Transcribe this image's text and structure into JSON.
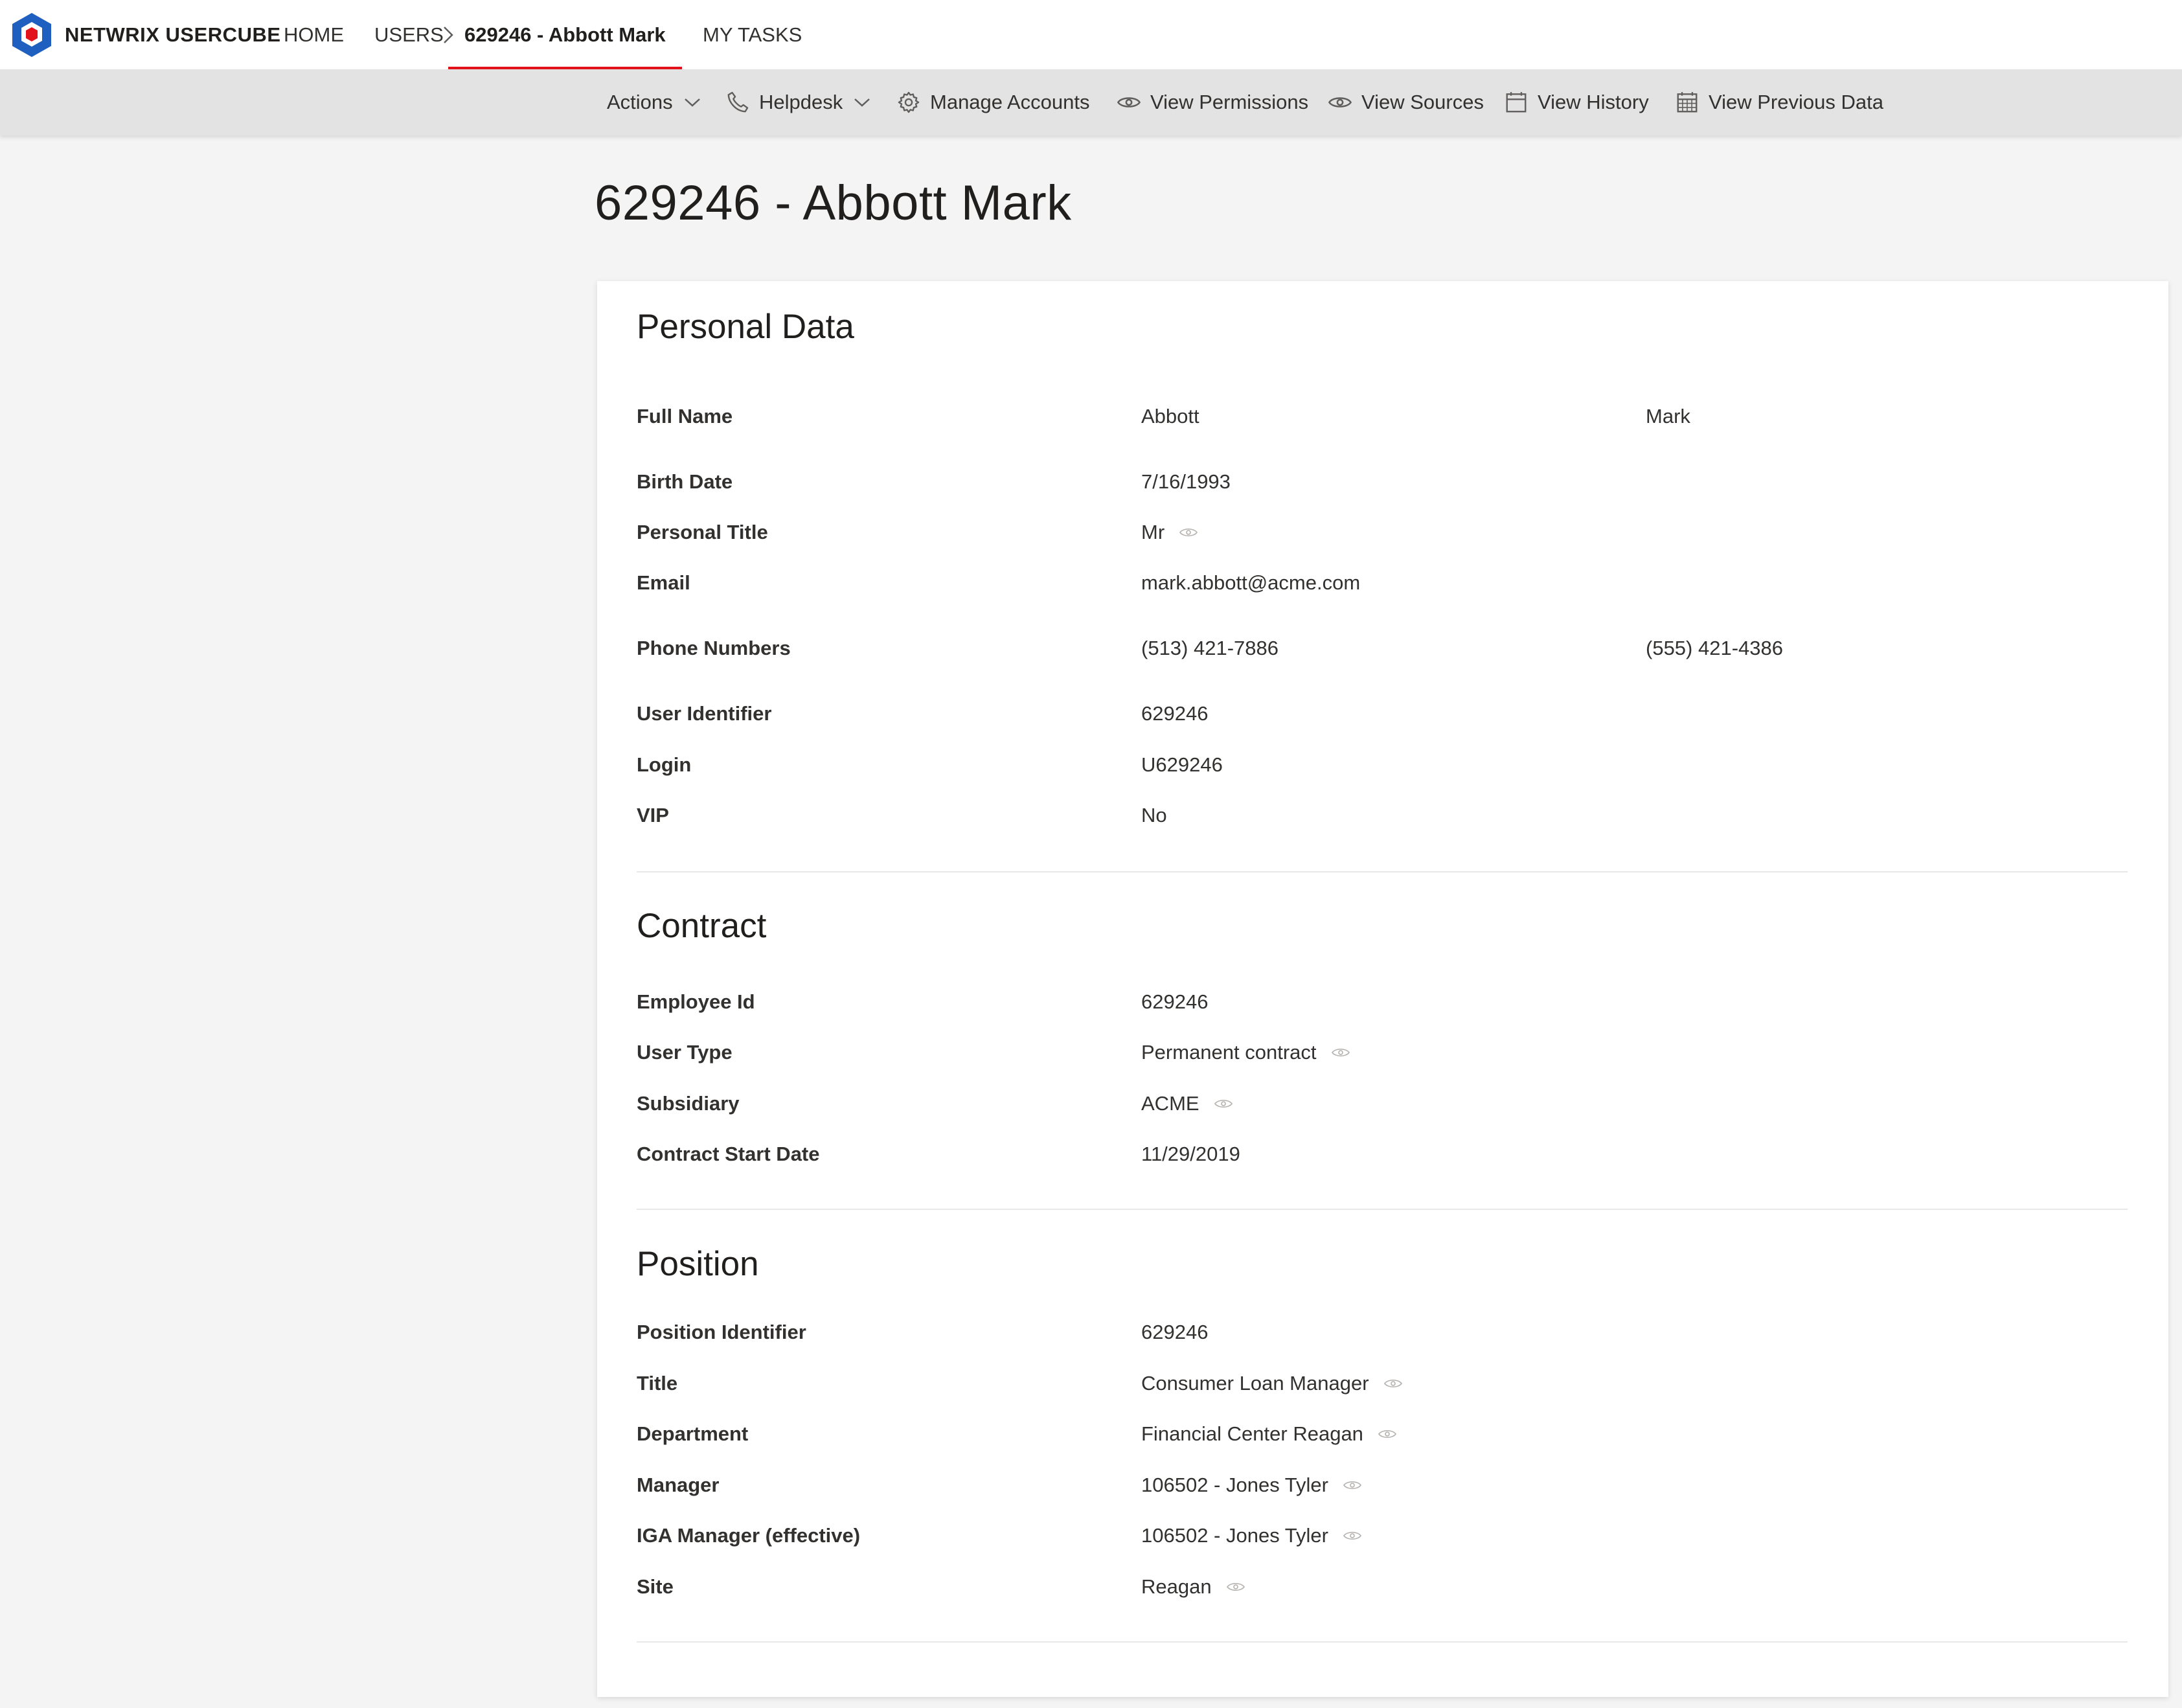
{
  "brand": {
    "name": "NETWRIX USERCUBE",
    "accent": "#e3131b",
    "logo_color": "#1f5fbf"
  },
  "nav": {
    "home": "HOME",
    "users": "USERS",
    "current": "629246 - Abbott Mark",
    "tasks": "MY TASKS"
  },
  "commands": {
    "actions": "Actions",
    "helpdesk": "Helpdesk",
    "manage_accounts": "Manage Accounts",
    "view_permissions": "View Permissions",
    "view_sources": "View Sources",
    "view_history": "View History",
    "view_previous_data": "View Previous Data"
  },
  "page_title": "629246 - Abbott Mark",
  "personal": {
    "title": "Personal Data",
    "full_name": {
      "label": "Full Name",
      "value": "Abbott",
      "value2": "Mark"
    },
    "birth_date": {
      "label": "Birth Date",
      "value": "7/16/1993"
    },
    "personal_title": {
      "label": "Personal Title",
      "value": "Mr"
    },
    "email": {
      "label": "Email",
      "value": "mark.abbott@acme.com"
    },
    "phones": {
      "label": "Phone Numbers",
      "value": "(513) 421-7886",
      "value2": "(555) 421-4386"
    },
    "user_identifier": {
      "label": "User Identifier",
      "value": "629246"
    },
    "login": {
      "label": "Login",
      "value": "U629246"
    },
    "vip": {
      "label": "VIP",
      "value": "No"
    }
  },
  "contract": {
    "title": "Contract",
    "employee_id": {
      "label": "Employee Id",
      "value": "629246"
    },
    "user_type": {
      "label": "User Type",
      "value": "Permanent contract"
    },
    "subsidiary": {
      "label": "Subsidiary",
      "value": "ACME"
    },
    "start_date": {
      "label": "Contract Start Date",
      "value": "11/29/2019"
    }
  },
  "position": {
    "title": "Position",
    "identifier": {
      "label": "Position Identifier",
      "value": "629246"
    },
    "job_title": {
      "label": "Title",
      "value": "Consumer Loan Manager"
    },
    "department": {
      "label": "Department",
      "value": "Financial Center Reagan"
    },
    "manager": {
      "label": "Manager",
      "value": "106502 - Jones Tyler"
    },
    "iga_manager": {
      "label": "IGA Manager (effective)",
      "value": "106502 - Jones Tyler"
    },
    "site": {
      "label": "Site",
      "value": "Reagan"
    }
  }
}
